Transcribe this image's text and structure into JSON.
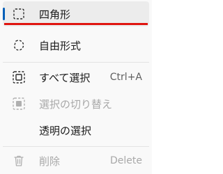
{
  "menu": {
    "items": [
      {
        "label": "四角形",
        "icon": "rectangle-select-icon",
        "shortcut": ""
      },
      {
        "label": "自由形式",
        "icon": "freeform-select-icon",
        "shortcut": ""
      },
      {
        "label": "すべて選択",
        "icon": "select-all-icon",
        "shortcut": "Ctrl+A"
      },
      {
        "label": "選択の切り替え",
        "icon": "invert-selection-icon",
        "shortcut": ""
      },
      {
        "label": "透明の選択",
        "icon": "",
        "shortcut": ""
      },
      {
        "label": "削除",
        "icon": "trash-icon",
        "shortcut": "Delete"
      }
    ],
    "selected_item": "四角形",
    "disabled_items": [
      "選択の切り替え",
      "削除"
    ]
  },
  "colors": {
    "accent": "#005fb8",
    "highlight_underline": "#e0140f",
    "text": "#1a1a1a",
    "disabled_text": "#a8a8a8"
  }
}
